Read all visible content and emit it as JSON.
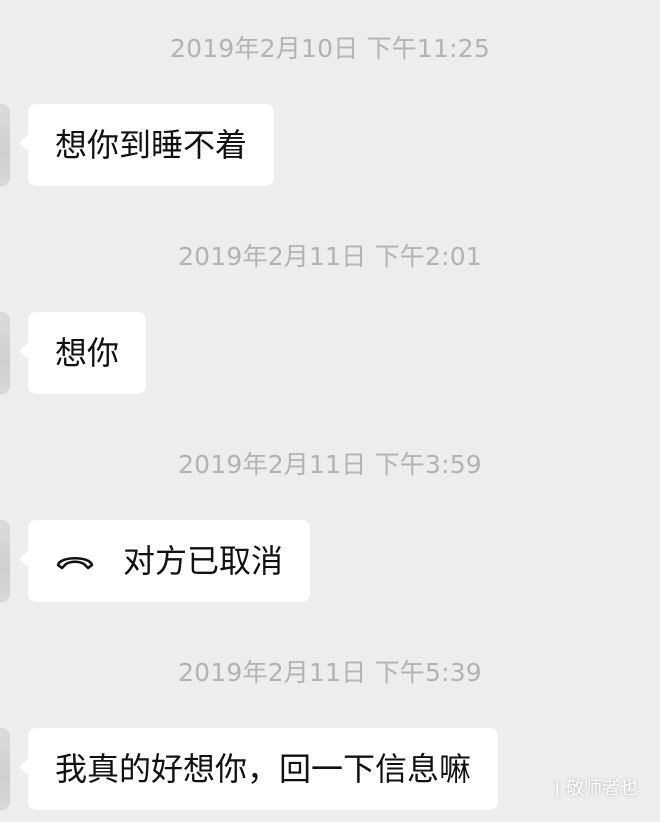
{
  "messages": [
    {
      "timestamp": "2019年2月10日 下午11:25",
      "text": "想你到睡不着"
    },
    {
      "timestamp": "2019年2月11日 下午2:01",
      "text": "想你"
    },
    {
      "timestamp": "2019年2月11日 下午3:59",
      "text": "对方已取消",
      "icon": "phone-hangup-icon"
    },
    {
      "timestamp": "2019年2月11日 下午5:39",
      "text": "我真的好想你，回一下信息嘛"
    }
  ],
  "watermark": "| 敬师者也",
  "colors": {
    "background": "#ededed",
    "bubble": "#ffffff",
    "timestamp": "#b3b3b3",
    "text": "#111111"
  }
}
